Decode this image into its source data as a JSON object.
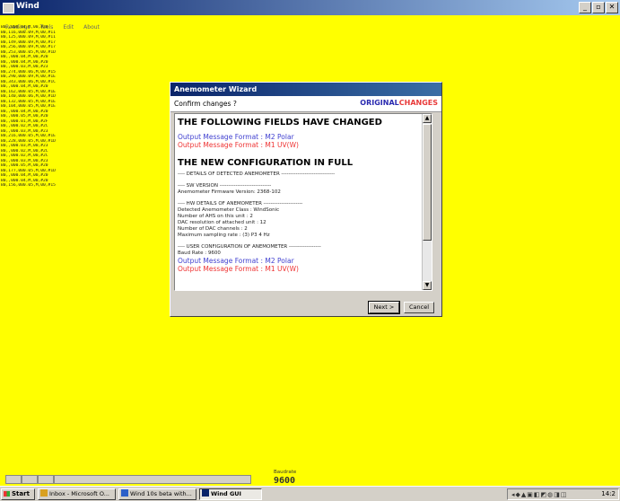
{
  "window": {
    "title": "Wind",
    "buttons": [
      "_",
      "▫",
      "✕"
    ]
  },
  "menu": [
    "Readings",
    "Tools",
    "Edit",
    "About"
  ],
  "log_lines": [
    "B0,,000.04,M,00,#20",
    "B0,116,000.09,M,00,#11",
    "B0,125,000.09,M,00,#11",
    "B0,149,000.09,M,00,#17",
    "B0,256,000.09,M,00,#17",
    "B0,253,000.05,M,00,#1D",
    "B0,,000.04,M,00,#20",
    "B0,,000.04,M,00,#20",
    "B0,,000.03,M,00,#23",
    "B0,274,000.06,M,00,#15",
    "B0,290,000.09,M,00,#1E",
    "B0,343,000.06,M,00,#1C",
    "B0,,000.04,M,00,#20",
    "B0,162,000.05,M,00,#1E",
    "B0,140,000.06,M,00,#1D",
    "B0,132,000.05,M,00,#1E",
    "B0,104,000.05,M,00,#1E",
    "B0,,000.04,M,00,#20",
    "B0,,000.05,M,00,#20",
    "B0,,000.01,M,00,#2F",
    "B0,,000.02,M,00,#2C",
    "B0,,000.03,M,00,#23",
    "B0,216,000.05,M,00,#1E",
    "B0,228,000.05,M,00,#1D",
    "B0,,000.03,M,00,#23",
    "B0,,000.02,M,00,#2C",
    "B0,,000.02,M,00,#2C",
    "B0,,000.03,M,00,#23",
    "B0,,000.05,M,00,#20",
    "B0,177,000.05,M,00,#1D",
    "B0,,000.04,M,00,#20",
    "B0,,000.04,M,00,#20",
    "B0,156,000.05,M,00,#15"
  ],
  "dialog": {
    "title": "Anemometer Wizard",
    "confirm": "Confirm changes ?",
    "original": "ORIGINAL",
    "changes": "CHANGES",
    "heading_changed": "THE FOLLOWING FIELDS HAVE CHANGED",
    "changed_new": "Output Message Format : M2 Polar",
    "changed_old": "Output Message Format : M1 UV(W)",
    "heading_full": "THE NEW CONFIGURATION IN FULL",
    "details_header": "---- DETAILS OF DETECTED ANEMOMETER ------------------------------",
    "sw_header": "---- SW VERSION -----------------------------",
    "sw_firmware": "Anemometer Firmware Version: 2368-102",
    "hw_header": "---- HW DETAILS OF ANEMOMETER ----------------------",
    "hw_lines": [
      "Detected Anemometer Class : WindSonic",
      "Number of AHS on this unit : 2",
      "DAC resolution of attached unit : 12",
      "Number of DAC channels : 2",
      "Maximum sampling rate : (3) P3 4 Hz"
    ],
    "user_header": "---- USER CONFIGURATION OF ANEMOMETER ------------------",
    "baud_line": "Baud Rate : 9600",
    "user_new": "Output Message Format : M2 Polar",
    "user_old": "Output Message Format : M1 UV(W)",
    "next_label": "Next >",
    "cancel_label": "Cancel"
  },
  "status": {
    "baud_label": "Baudrate",
    "baud_value": "9600"
  },
  "taskbar": {
    "start_label": "Start",
    "tasks": [
      "Inbox - Microsoft O...",
      "Wind 10s beta with...",
      "Wind GUI"
    ],
    "clock": "14:2"
  },
  "colors": {
    "background": "#ffff00",
    "original": "#2a2ab0",
    "changes": "#e83a3a",
    "new_value": "#4040d0",
    "old_value": "#e33333"
  }
}
